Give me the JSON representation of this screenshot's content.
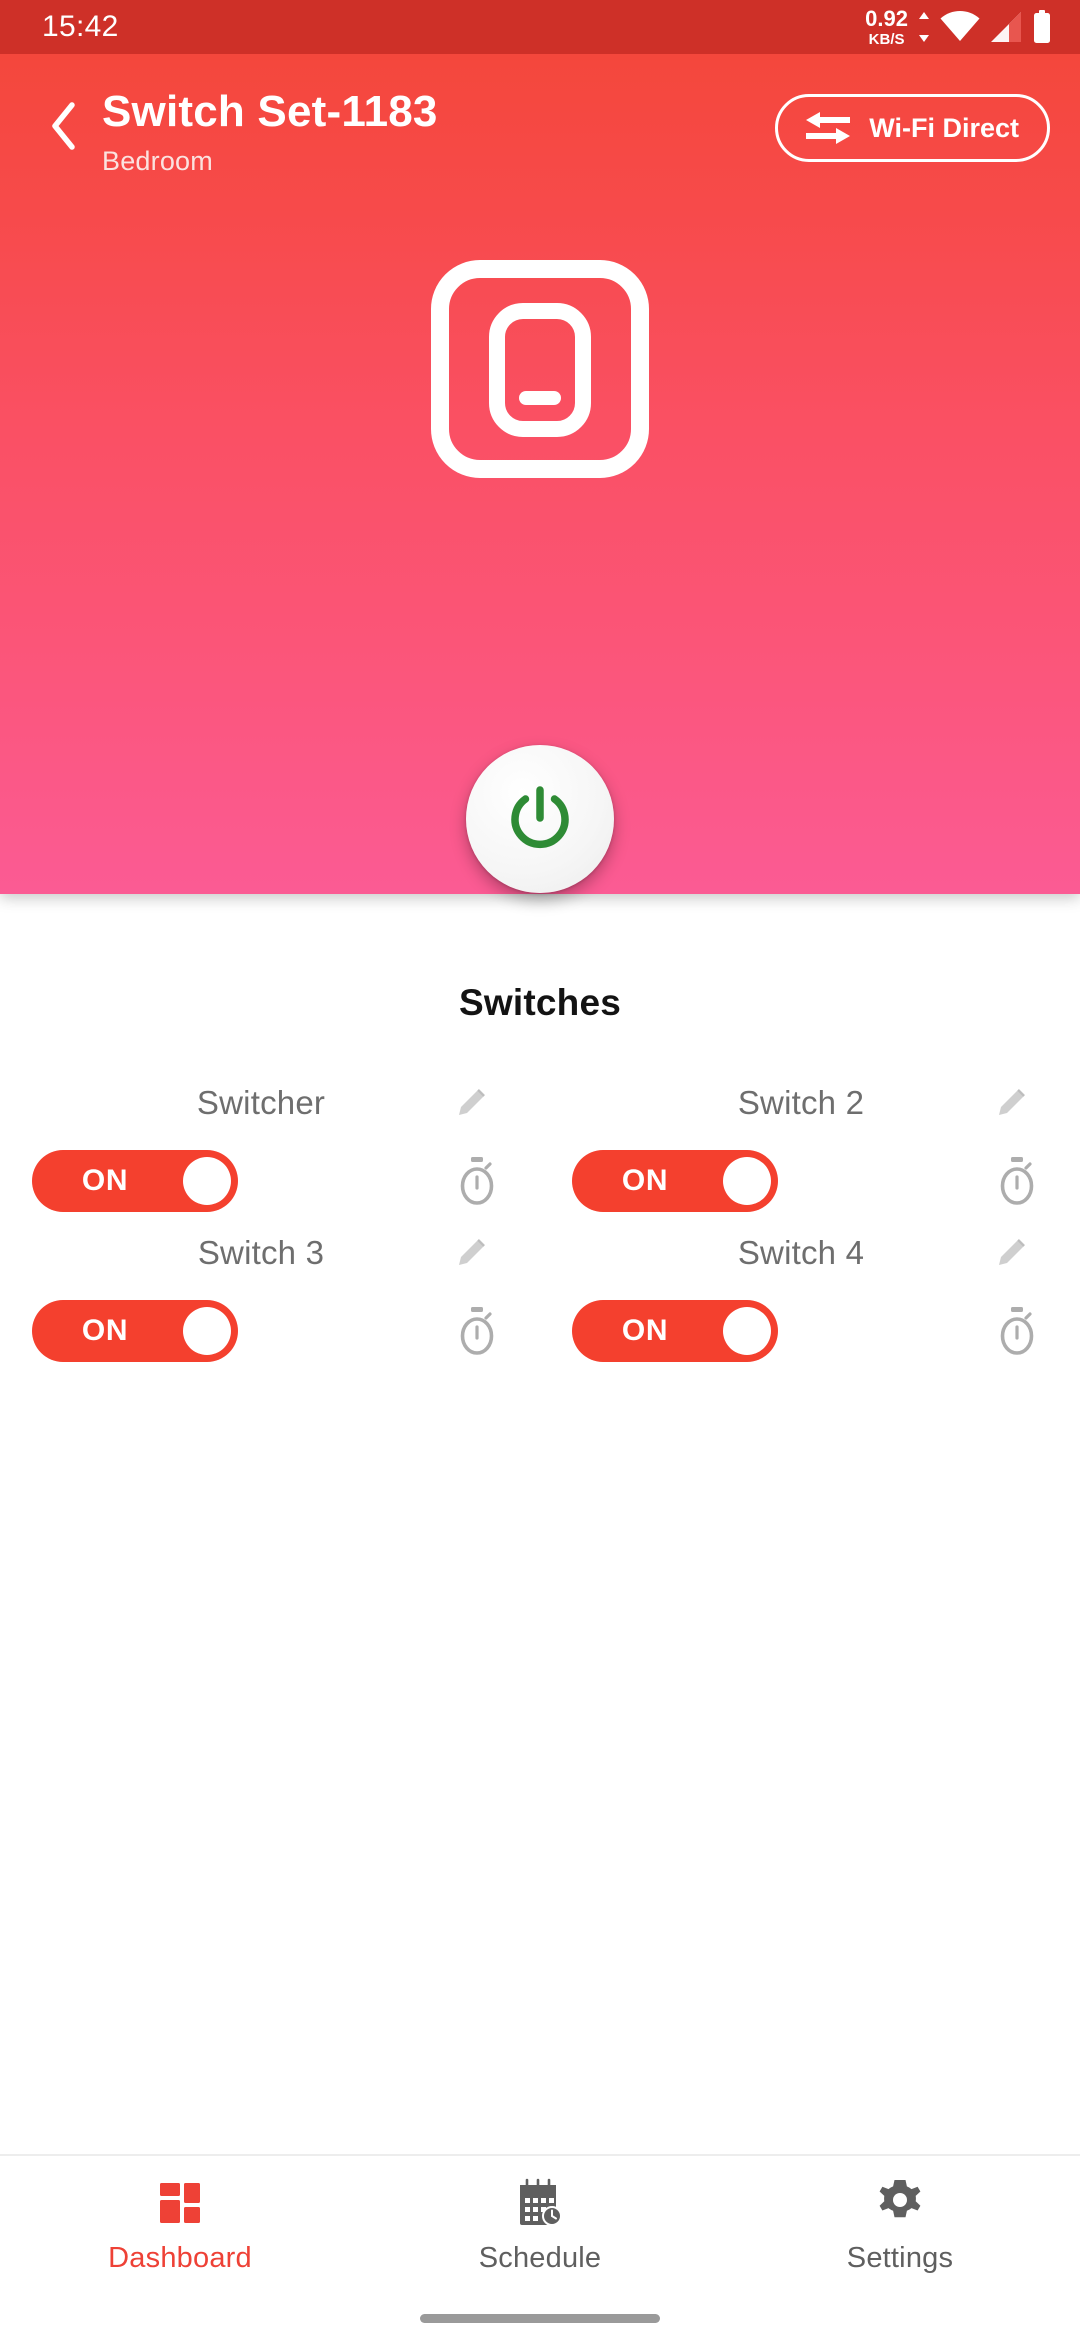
{
  "status_bar": {
    "clock": "15:42",
    "network_speed_value": "0.92",
    "network_speed_unit": "KB/S",
    "icons": [
      "data-transfer-icon",
      "wifi-icon",
      "cellular-signal-icon",
      "battery-icon"
    ],
    "background_color": "#CE3028"
  },
  "header": {
    "back_label": "back-arrow",
    "title": "Switch Set-1183",
    "room": "Bedroom",
    "wifi_direct_label": "Wi-Fi Direct",
    "gradient_start_color": "#F4473C",
    "gradient_end_color": "#FB5B94"
  },
  "device": {
    "illustration": "wall-switch-icon",
    "power_button_state": "on",
    "power_icon_color": "#2E8B35"
  },
  "main": {
    "section_title": "Switches",
    "switches": [
      {
        "name": "Switcher",
        "state_label": "ON",
        "state": "on"
      },
      {
        "name": "Switch 2",
        "state_label": "ON",
        "state": "on"
      },
      {
        "name": "Switch 3",
        "state_label": "ON",
        "state": "on"
      },
      {
        "name": "Switch 4",
        "state_label": "ON",
        "state": "on"
      }
    ],
    "edit_icon": "pencil-icon",
    "timer_icon": "stopwatch-icon",
    "toggle_on_color": "#F4402E"
  },
  "bottom_nav": {
    "active_color": "#EE4136",
    "inactive_color": "#5F5F5F",
    "items": [
      {
        "label": "Dashboard",
        "icon": "dashboard-grid-icon",
        "active": true
      },
      {
        "label": "Schedule",
        "icon": "calendar-clock-icon",
        "active": false
      },
      {
        "label": "Settings",
        "icon": "gear-icon",
        "active": false
      }
    ]
  }
}
